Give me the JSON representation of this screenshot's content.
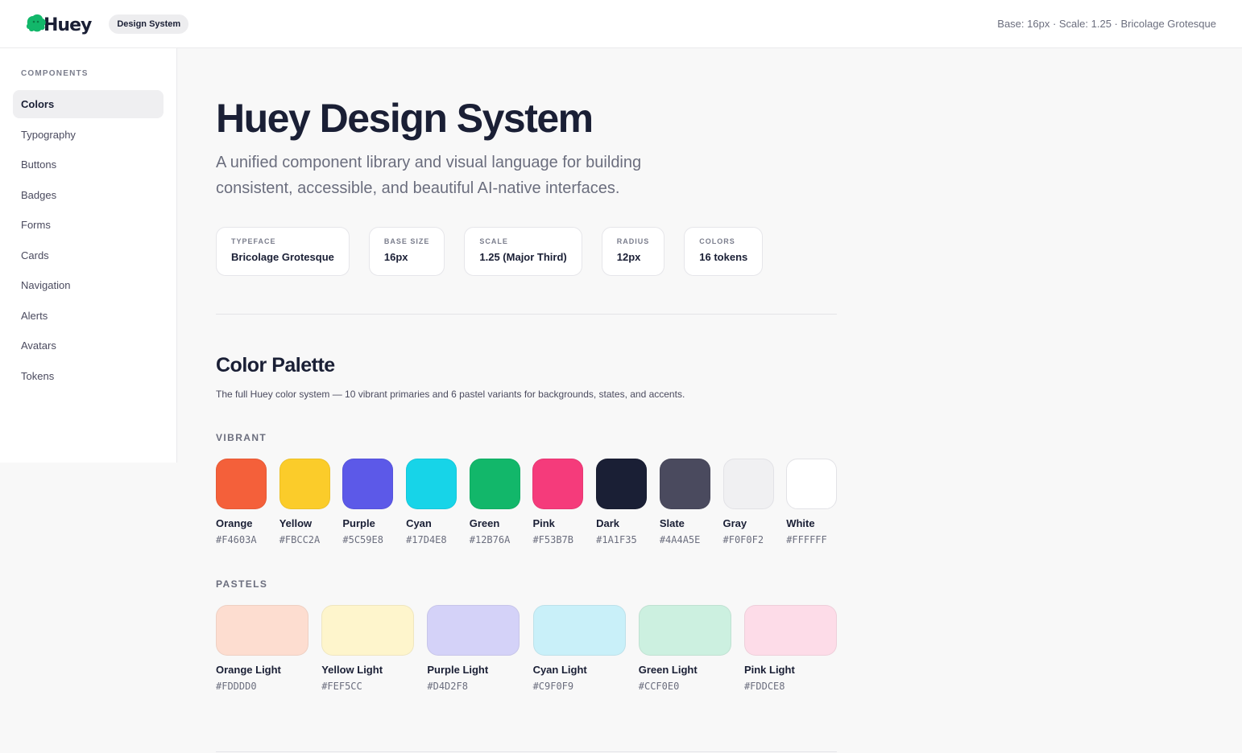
{
  "header": {
    "logo_text": "Huey",
    "badge": "Design System",
    "meta": "Base: 16px · Scale: 1.25 · Bricolage Grotesque"
  },
  "sidebar": {
    "heading": "COMPONENTS",
    "items": [
      {
        "label": "Colors",
        "active": true
      },
      {
        "label": "Typography"
      },
      {
        "label": "Buttons"
      },
      {
        "label": "Badges"
      },
      {
        "label": "Forms"
      },
      {
        "label": "Cards"
      },
      {
        "label": "Navigation"
      },
      {
        "label": "Alerts"
      },
      {
        "label": "Avatars"
      },
      {
        "label": "Tokens"
      }
    ]
  },
  "main": {
    "title": "Huey Design System",
    "subtitle": "A unified component library and visual language for building consistent, accessible, and beautiful AI-native interfaces.",
    "stats": [
      {
        "label": "TYPEFACE",
        "value": "Bricolage Grotesque"
      },
      {
        "label": "BASE SIZE",
        "value": "16px"
      },
      {
        "label": "SCALE",
        "value": "1.25 (Major Third)"
      },
      {
        "label": "RADIUS",
        "value": "12px"
      },
      {
        "label": "COLORS",
        "value": "16 tokens"
      }
    ],
    "palette": {
      "title": "Color Palette",
      "description": "The full Huey color system — 10 vibrant primaries and 6 pastel variants for backgrounds, states, and accents.",
      "vibrant_label": "VIBRANT",
      "vibrant": [
        {
          "name": "Orange",
          "hex": "#F4603A"
        },
        {
          "name": "Yellow",
          "hex": "#FBCC2A"
        },
        {
          "name": "Purple",
          "hex": "#5C59E8"
        },
        {
          "name": "Cyan",
          "hex": "#17D4E8"
        },
        {
          "name": "Green",
          "hex": "#12B76A"
        },
        {
          "name": "Pink",
          "hex": "#F53B7B"
        },
        {
          "name": "Dark",
          "hex": "#1A1F35"
        },
        {
          "name": "Slate",
          "hex": "#4A4A5E"
        },
        {
          "name": "Gray",
          "hex": "#F0F0F2"
        },
        {
          "name": "White",
          "hex": "#FFFFFF"
        }
      ],
      "pastels_label": "PASTELS",
      "pastels": [
        {
          "name": "Orange Light",
          "hex": "#FDDDD0"
        },
        {
          "name": "Yellow Light",
          "hex": "#FEF5CC"
        },
        {
          "name": "Purple Light",
          "hex": "#D4D2F8"
        },
        {
          "name": "Cyan Light",
          "hex": "#C9F0F9"
        },
        {
          "name": "Green Light",
          "hex": "#CCF0E0"
        },
        {
          "name": "Pink Light",
          "hex": "#FDDCE8"
        }
      ]
    }
  },
  "colors": {
    "brand_green": "#12B76A",
    "text_dark": "#1A1F35",
    "text_muted": "#6B6E7E"
  }
}
